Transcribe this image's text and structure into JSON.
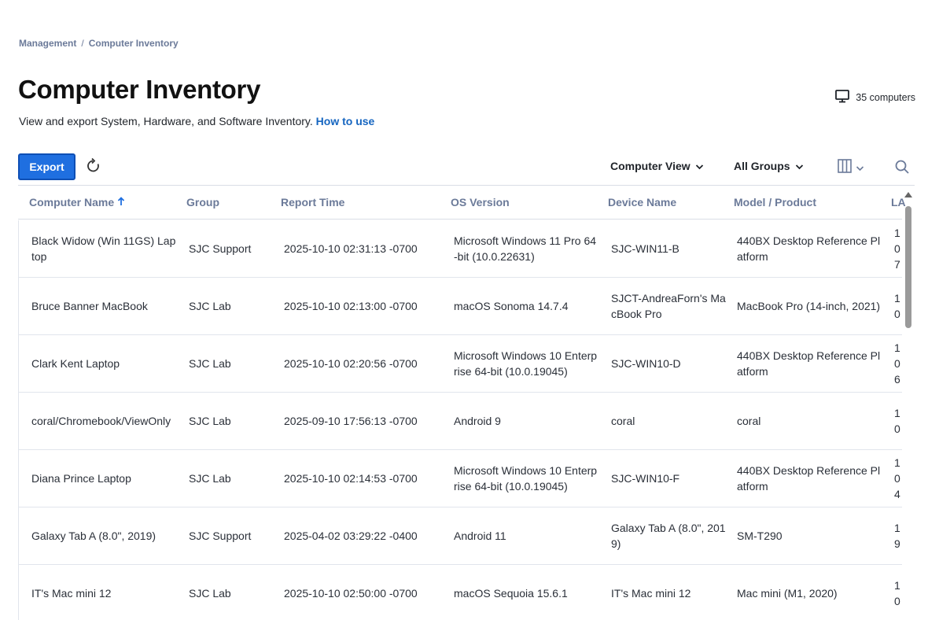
{
  "breadcrumb": {
    "parent": "Management",
    "separator": "/",
    "current": "Computer Inventory"
  },
  "page": {
    "title": "Computer Inventory",
    "subtitle": "View and export System, Hardware, and Software Inventory.",
    "help_link": "How to use",
    "count_label": "35 computers"
  },
  "toolbar": {
    "export_label": "Export",
    "view_dropdown": "Computer View",
    "groups_dropdown": "All Groups"
  },
  "table": {
    "headers": [
      "Computer Name",
      "Group",
      "Report Time",
      "OS Version",
      "Device Name",
      "Model / Product",
      "LA"
    ],
    "sort": {
      "column": "Computer Name",
      "direction": "ascending"
    },
    "rows": [
      [
        "Black Widow (Win 11GS) Laptop",
        "SJC Support",
        "2025-10-10 02:31:13 -0700",
        "Microsoft Windows 11 Pro 64-bit (10.0.22631)",
        "SJC-WIN11-B",
        "440BX Desktop Reference Platform",
        "10 7"
      ],
      [
        "Bruce Banner MacBook",
        "SJC Lab",
        "2025-10-10 02:13:00 -0700",
        "macOS Sonoma 14.7.4",
        "SJCT-AndreaForn's MacBook Pro",
        "MacBook Pro (14-inch, 2021)",
        "10"
      ],
      [
        "Clark Kent Laptop",
        "SJC Lab",
        "2025-10-10 02:20:56 -0700",
        "Microsoft Windows 10 Enterprise 64-bit (10.0.19045)",
        "SJC-WIN10-D",
        "440BX Desktop Reference Platform",
        "10 6"
      ],
      [
        "coral/Chromebook/ViewOnly",
        "SJC Lab",
        "2025-09-10 17:56:13 -0700",
        "Android 9",
        "coral",
        "coral",
        "10"
      ],
      [
        "Diana Prince Laptop",
        "SJC Lab",
        "2025-10-10 02:14:53 -0700",
        "Microsoft Windows 10 Enterprise 64-bit (10.0.19045)",
        "SJC-WIN10-F",
        "440BX Desktop Reference Platform",
        "10 4"
      ],
      [
        "Galaxy Tab A (8.0\", 2019)",
        "SJC Support",
        "2025-04-02 03:29:22 -0400",
        "Android 11",
        "Galaxy Tab A (8.0\", 2019)",
        "SM-T290",
        "19"
      ],
      [
        "IT's Mac mini 12",
        "SJC Lab",
        "2025-10-10 02:50:00 -0700",
        "macOS Sequoia 15.6.1",
        "IT's Mac mini 12",
        "Mac mini (M1, 2020)",
        "10"
      ]
    ]
  },
  "colors": {
    "accent": "#1f6fe0",
    "header_text": "#6b7a99",
    "link": "#1565c0"
  },
  "icons": {
    "count": "monitor-icon",
    "refresh": "refresh-icon",
    "columns": "columns-icon",
    "search": "search-icon",
    "sort": "arrow-up-icon",
    "dropdown": "chevron-down-icon"
  }
}
